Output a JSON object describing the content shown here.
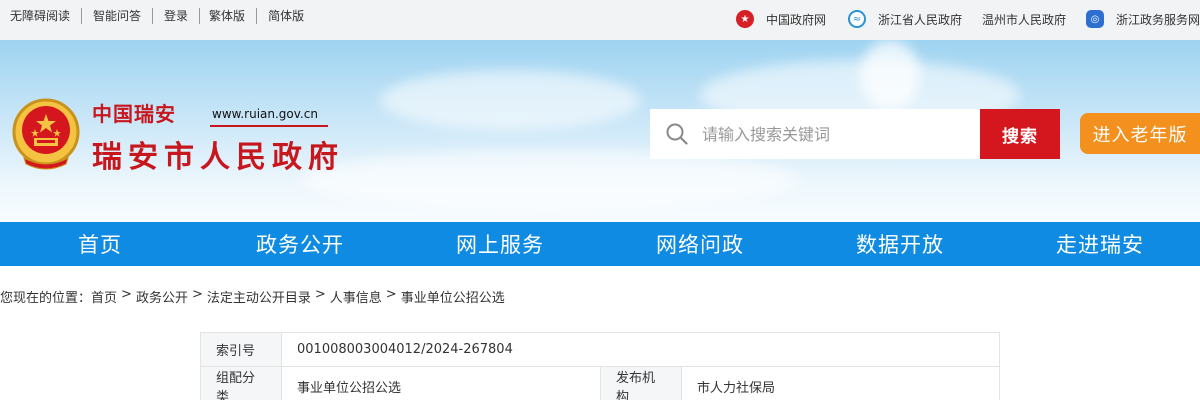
{
  "topbar": {
    "left_links": [
      "无障碍阅读",
      "智能问答",
      "登录",
      "繁体版",
      "简体版"
    ],
    "right_links": [
      {
        "label": "中国政府网",
        "icon": "national-emblem-icon",
        "color": "#d71f27"
      },
      {
        "label": "浙江省人民政府",
        "icon": "zhejiang-logo-icon",
        "color": "#2a93d6"
      },
      {
        "label": "温州市人民政府",
        "icon": "",
        "color": ""
      },
      {
        "label": "浙江政务服务网",
        "icon": "zjzwfw-logo-icon",
        "color": "#2c6fd1"
      }
    ]
  },
  "header": {
    "brand_small": "中国瑞安",
    "url": "www.ruian.gov.cn",
    "brand_big": "瑞安市人民政府",
    "search_placeholder": "请输入搜索关键词",
    "search_button": "搜索",
    "elder_button": "进入老年版",
    "colors": {
      "brand_red": "#c8161d",
      "search_red": "#d4161f",
      "elder_orange": "#f4901e"
    }
  },
  "nav": {
    "items": [
      "首页",
      "政务公开",
      "网上服务",
      "网络问政",
      "数据开放",
      "走进瑞安"
    ],
    "color": "#0f8be3"
  },
  "breadcrumb": {
    "prefix": "您现在的位置：",
    "items": [
      "首页",
      "政务公开",
      "法定主动公开目录",
      "人事信息",
      "事业单位公招公选"
    ],
    "separator": ">"
  },
  "info": {
    "index_label": "索引号",
    "index_value": "001008003004012/2024-267804",
    "category_label": "组配分类",
    "category_value": "事业单位公招公选",
    "publisher_label": "发布机构",
    "publisher_value": "市人力社保局"
  }
}
